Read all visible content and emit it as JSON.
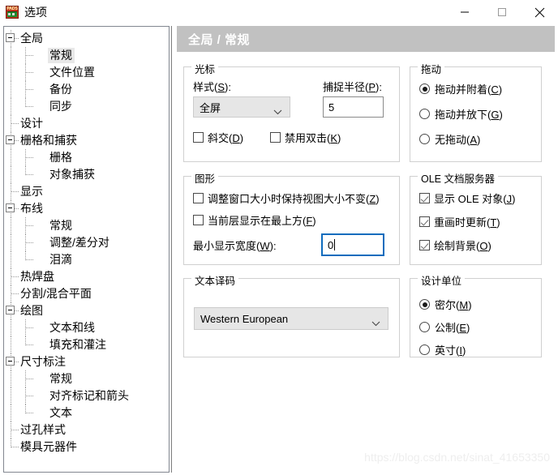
{
  "window": {
    "title": "选项",
    "icon": "pads-app-icon",
    "controls": {
      "minimize": "minimize-icon",
      "maximize": "maximize-icon",
      "close": "close-icon"
    }
  },
  "tree": {
    "items": [
      {
        "label": "全局",
        "level": 0,
        "expander": "minus",
        "selected": false
      },
      {
        "label": "常规",
        "level": 1,
        "expander": "none",
        "selected": true
      },
      {
        "label": "文件位置",
        "level": 1,
        "expander": "none",
        "selected": false
      },
      {
        "label": "备份",
        "level": 1,
        "expander": "none",
        "selected": false
      },
      {
        "label": "同步",
        "level": 1,
        "expander": "none",
        "selected": false
      },
      {
        "label": "设计",
        "level": 0,
        "expander": "none",
        "selected": false
      },
      {
        "label": "栅格和捕获",
        "level": 0,
        "expander": "minus",
        "selected": false
      },
      {
        "label": "栅格",
        "level": 1,
        "expander": "none",
        "selected": false
      },
      {
        "label": "对象捕获",
        "level": 1,
        "expander": "none",
        "selected": false
      },
      {
        "label": "显示",
        "level": 0,
        "expander": "none",
        "selected": false
      },
      {
        "label": "布线",
        "level": 0,
        "expander": "minus",
        "selected": false
      },
      {
        "label": "常规",
        "level": 1,
        "expander": "none",
        "selected": false
      },
      {
        "label": "调整/差分对",
        "level": 1,
        "expander": "none",
        "selected": false
      },
      {
        "label": "泪滴",
        "level": 1,
        "expander": "none",
        "selected": false
      },
      {
        "label": "热焊盘",
        "level": 0,
        "expander": "none",
        "selected": false
      },
      {
        "label": "分割/混合平面",
        "level": 0,
        "expander": "none",
        "selected": false
      },
      {
        "label": "绘图",
        "level": 0,
        "expander": "minus",
        "selected": false
      },
      {
        "label": "文本和线",
        "level": 1,
        "expander": "none",
        "selected": false
      },
      {
        "label": "填充和灌注",
        "level": 1,
        "expander": "none",
        "selected": false
      },
      {
        "label": "尺寸标注",
        "level": 0,
        "expander": "minus",
        "selected": false
      },
      {
        "label": "常规",
        "level": 1,
        "expander": "none",
        "selected": false
      },
      {
        "label": "对齐标记和箭头",
        "level": 1,
        "expander": "none",
        "selected": false
      },
      {
        "label": "文本",
        "level": 1,
        "expander": "none",
        "selected": false
      },
      {
        "label": "过孔样式",
        "level": 0,
        "expander": "none",
        "selected": false
      },
      {
        "label": "模具元器件",
        "level": 0,
        "expander": "none",
        "selected": false
      }
    ]
  },
  "page": {
    "header": "全局 / 常规",
    "cursor_group": {
      "title": "光标",
      "style_label": "样式(S):",
      "style_label_plain": "样式(",
      "style_accel": "S",
      "style_value": "全屏",
      "snap_label_plain": "捕捉半径(",
      "snap_accel": "P",
      "snap_value": "5",
      "checkboxes": [
        {
          "plain": "斜交(",
          "accel": "D",
          "checked": false
        },
        {
          "plain": "禁用双击(",
          "accel": "K",
          "checked": false
        }
      ]
    },
    "drag_group": {
      "title": "拖动",
      "options": [
        {
          "plain": "拖动并附着(",
          "accel": "C",
          "selected": true
        },
        {
          "plain": "拖动并放下(",
          "accel": "G",
          "selected": false
        },
        {
          "plain": "无拖动(",
          "accel": "A",
          "selected": false
        }
      ]
    },
    "graphics_group": {
      "title": "图形",
      "checkboxes": [
        {
          "plain": "调整窗口大小时保持视图大小不变(",
          "accel": "Z",
          "checked": false
        },
        {
          "plain": "当前层显示在最上方(",
          "accel": "F",
          "checked": false
        }
      ],
      "minwidth_plain": "最小显示宽度(",
      "minwidth_accel": "W",
      "minwidth_value": "0"
    },
    "ole_group": {
      "title": "OLE 文档服务器",
      "checkboxes": [
        {
          "plain": "显示 OLE 对象(",
          "accel": "J",
          "checked": true
        },
        {
          "plain": "重画时更新(",
          "accel": "T",
          "checked": true
        },
        {
          "plain": "绘制背景(",
          "accel": "O",
          "checked": true
        }
      ]
    },
    "textdecode_group": {
      "title": "文本译码",
      "value": "Western European"
    },
    "units_group": {
      "title": "设计单位",
      "options": [
        {
          "plain": "密尔(",
          "accel": "M",
          "selected": true
        },
        {
          "plain": "公制(",
          "accel": "E",
          "selected": false
        },
        {
          "plain": "英寸(",
          "accel": "I",
          "selected": false
        }
      ]
    }
  },
  "watermark": "https://blog.csdn.net/sinat_41653350"
}
